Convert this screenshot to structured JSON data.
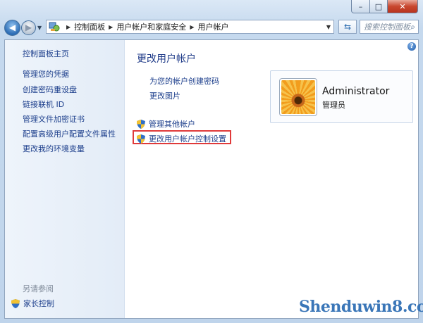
{
  "window": {
    "caption": {
      "minimize": "–",
      "maximize": "□",
      "close": "✕"
    }
  },
  "nav": {
    "back_icon": "arrow-left-icon",
    "forward_icon": "arrow-right-icon",
    "breadcrumbs": [
      "控制面板",
      "用户帐户和家庭安全",
      "用户帐户"
    ],
    "search_placeholder": "搜索控制面板"
  },
  "sidebar": {
    "items": [
      {
        "label": "控制面板主页"
      },
      {
        "label": "管理您的凭据"
      },
      {
        "label": "创建密码重设盘"
      },
      {
        "label": "链接联机 ID"
      },
      {
        "label": "管理文件加密证书"
      },
      {
        "label": "配置高级用户配置文件属性"
      },
      {
        "label": "更改我的环境变量"
      }
    ],
    "see_also": "另请参阅",
    "family_safety": "家长控制"
  },
  "main": {
    "title": "更改用户帐户",
    "tasks": [
      "为您的帐户创建密码",
      "更改图片"
    ],
    "manage_other": "管理其他帐户",
    "uac_settings": "更改用户帐户控制设置"
  },
  "user": {
    "name": "Administrator",
    "role": "管理员"
  },
  "watermark": "Shenduwin8.com",
  "colors": {
    "link": "#1d3f8c",
    "title": "#1e3a88",
    "highlight": "#e03a3a"
  }
}
